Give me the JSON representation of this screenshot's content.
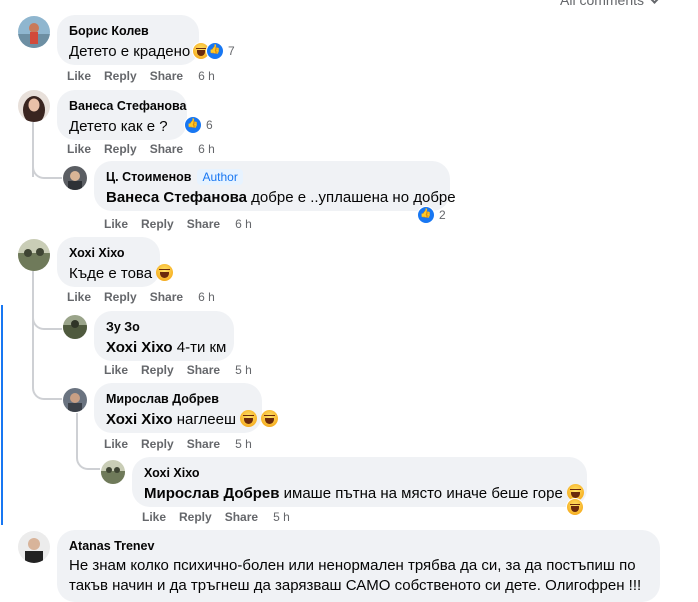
{
  "header": {
    "sort_label": "All comments"
  },
  "actions": {
    "like": "Like",
    "reply": "Reply",
    "share": "Share"
  },
  "comments": [
    {
      "author": "Борис Колев",
      "text": "Детето е крадено",
      "time": "6 h",
      "reactions": {
        "icons": [
          "haha-icon",
          "like-icon"
        ],
        "count": "7"
      }
    },
    {
      "author": "Ванеса Стефанова",
      "text": "Детето как е ?",
      "time": "6 h",
      "reactions": {
        "icons": [
          "like-icon"
        ],
        "count": "6"
      },
      "replies": [
        {
          "author": "Ц. Стоименов",
          "badge": "Author",
          "mention": "Ванеса Стефанова",
          "text": " добре е ..уплашена но добре",
          "time": "6 h",
          "reactions": {
            "icons": [
              "like-icon"
            ],
            "count": "2"
          }
        }
      ]
    },
    {
      "author": "Хохі Хіхо",
      "text": "Къде е това",
      "time": "6 h",
      "emoji": "haha-emoji",
      "replies": [
        {
          "author": "Зу Зо",
          "mention": "Хохі Хіхо",
          "text": " 4-ти км",
          "time": "5 h"
        },
        {
          "author": "Мирослав Добрев",
          "mention": "Хохі Хіхо",
          "text": " наглееш",
          "time": "5 h",
          "emojis": [
            "smile-emoji",
            "haha-emoji"
          ],
          "replies": [
            {
              "author": "Хохі Хіхо",
              "mention": "Мирослав Добрев",
              "text": " имаше пътна на място иначе беше горе",
              "time": "5 h",
              "emojis": [
                "haha-emoji"
              ],
              "reactions": {
                "icons": [
                  "haha-icon"
                ],
                "count": ""
              }
            }
          ]
        }
      ]
    },
    {
      "author": "Atanas Trenev",
      "text_line1": "Не знам колко психично-болен или ненормален трябва да си, за да постъпиш по",
      "text_line2": "такъв начин и да тръгнеш да зарязваш САМО собственото си дете. Олигофрен !!!"
    }
  ],
  "colors": {
    "bubble": "#f0f2f5",
    "link": "#1877f2",
    "meta": "#65676b"
  }
}
